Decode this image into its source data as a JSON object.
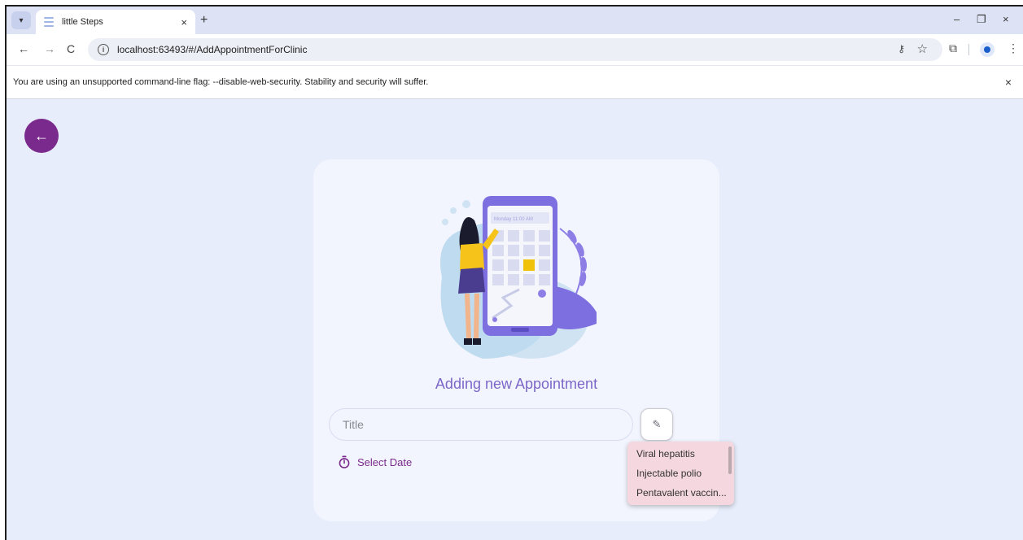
{
  "browser": {
    "tab_title": "little Steps",
    "tab_close": "×",
    "new_tab": "+",
    "url": "localhost:63493/#/AddAppointmentForClinic",
    "infobar_message": "You are using an unsupported command-line flag: --disable-web-security. Stability and security will suffer.",
    "infobar_close": "×",
    "window_controls": {
      "minimize": "–",
      "restore": "❐",
      "close": "×"
    },
    "nav": {
      "back": "←",
      "forward": "→",
      "reload": "C"
    },
    "icons": [
      "chevron-down-icon",
      "key-icon",
      "star-icon",
      "extensions-icon",
      "profile-icon",
      "more-icon"
    ]
  },
  "page": {
    "back_button_icon": "arrow-left-icon",
    "heading": "Adding new Appointment",
    "title_placeholder": "Title",
    "select_date_label": "Select Date",
    "vaccine_options": [
      "Viral hepatitis",
      "Injectable polio",
      "Pentavalent vaccin..."
    ],
    "illustration_text": "Monday 11:00 AM"
  },
  "colors": {
    "accent": "#7a2a8c",
    "heading": "#7c67c8",
    "card_bg": "#f2f5fe",
    "page_bg": "#e8edfb",
    "dropdown_bg": "#f4d7df"
  }
}
